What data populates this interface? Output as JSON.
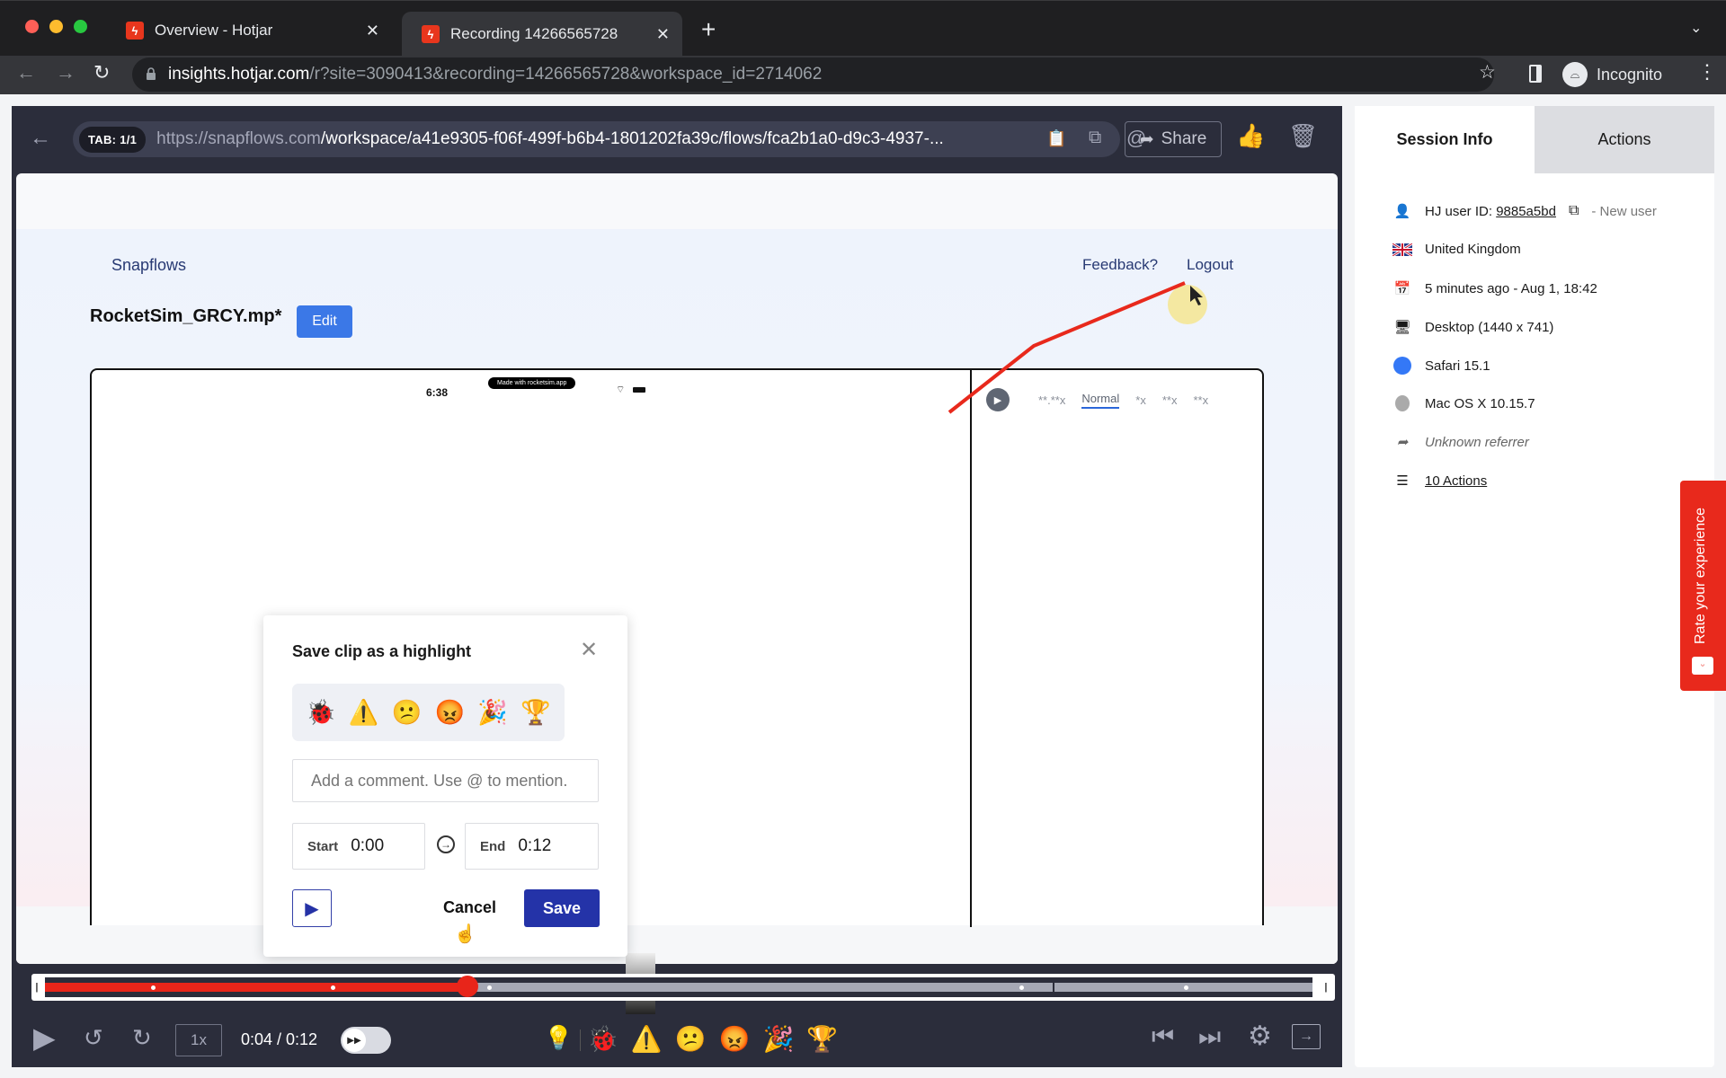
{
  "browser": {
    "tabs": [
      {
        "title": "Overview - Hotjar",
        "active": false
      },
      {
        "title": "Recording 14266565728",
        "active": true
      }
    ],
    "new_tab_icon": "plus-icon",
    "address": {
      "host": "insights.hotjar.com",
      "path": "/r?site=3090413&recording=14266565728&workspace_id=2714062"
    },
    "profile_label": "Incognito"
  },
  "player": {
    "tab_badge": "TAB: 1/1",
    "url_host": "https://snapflows.com",
    "url_path": "/workspace/a41e9305-f06f-499f-b6b4-1801202fa39c/flows/fca2b1a0-d9c3-4937-...",
    "share_label": "Share"
  },
  "recorded_page": {
    "logo": "Snapflows",
    "nav_links": [
      "Feedback?",
      "Logout"
    ],
    "file_title": "RocketSim_GRCY.mp*",
    "edit_label": "Edit",
    "phone_time": "6:38",
    "made_with": "Made with rocketsim.app",
    "speed_options": [
      "**.**x",
      "Normal",
      "*x",
      "**x",
      "**x"
    ],
    "selected_speed": "Normal"
  },
  "highlight_modal": {
    "title": "Save clip as a highlight",
    "reactions": [
      "🐞",
      "⚠️",
      "😕",
      "😡",
      "🎉",
      "🏆"
    ],
    "comment_placeholder": "Add a comment. Use @ to mention.",
    "comment_value": "",
    "start_label": "Start",
    "start_value": "0:00",
    "end_label": "End",
    "end_value": "0:12",
    "cancel_label": "Cancel",
    "save_label": "Save"
  },
  "timeline": {
    "progress": 0.3333,
    "event_markers": [
      0.085,
      0.227,
      0.35,
      0.77,
      0.9
    ],
    "segment_marker": 0.795
  },
  "controls": {
    "speed": "1x",
    "timecode": "0:04 / 0:12",
    "skip_inactivity": true,
    "reactions": [
      "🐞",
      "⚠️",
      "😕",
      "😡",
      "🎉",
      "🏆"
    ]
  },
  "session_info": {
    "tabs": [
      "Session Info",
      "Actions"
    ],
    "active_tab": "Session Info",
    "user_label": "HJ user ID: ",
    "user_id": "9885a5bd",
    "user_status": "- New user",
    "country": "United Kingdom",
    "time": "5 minutes ago - Aug 1, 18:42",
    "device": "Desktop (1440 x 741)",
    "browser": "Safari 15.1",
    "os": "Mac OS X 10.15.7",
    "referrer": "Unknown referrer",
    "actions_link": "10 Actions"
  },
  "feedback_widget": {
    "label": "Rate your experience",
    "color": "#e8291c"
  },
  "colors": {
    "accent_red": "#e8251a",
    "player_bg": "#2b2d3b",
    "save_blue": "#2433a8",
    "edit_blue": "#3b78e7"
  }
}
